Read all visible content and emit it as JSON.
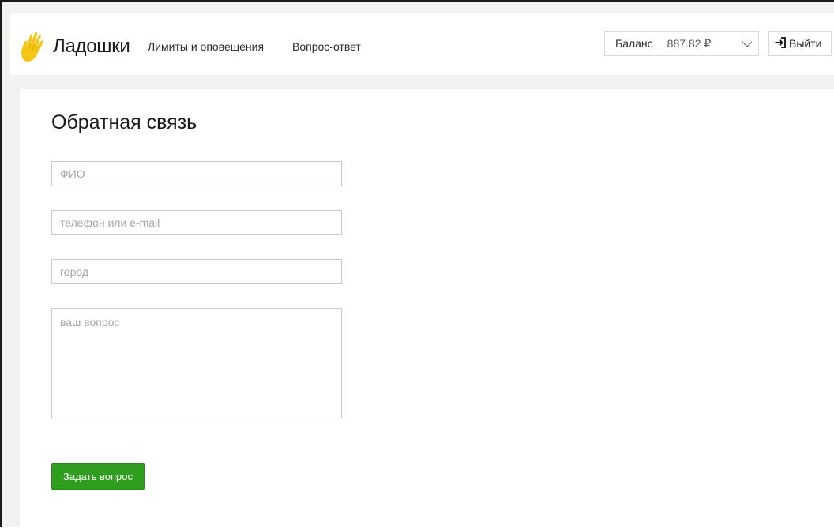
{
  "header": {
    "logo_text": "Ладошки",
    "nav": [
      {
        "label": "Лимиты и оповещения"
      },
      {
        "label": "Вопрос-ответ"
      }
    ],
    "balance": {
      "label": "Баланс",
      "amount": "887.82 ₽"
    },
    "logout_label": "Выйти"
  },
  "form": {
    "title": "Обратная связь",
    "fields": {
      "name_placeholder": "ФИО",
      "contact_placeholder": "телефон или e-mail",
      "city_placeholder": "город",
      "question_placeholder": "ваш вопрос"
    },
    "submit_label": "Задать вопрос"
  },
  "colors": {
    "accent_green": "#2f9e1e",
    "logo_yellow": "#f5c518",
    "page_background": "#f2f2f0"
  },
  "icons": {
    "logo": "hand-icon",
    "balance_toggle": "chevron-down-icon",
    "logout": "logout-icon"
  }
}
